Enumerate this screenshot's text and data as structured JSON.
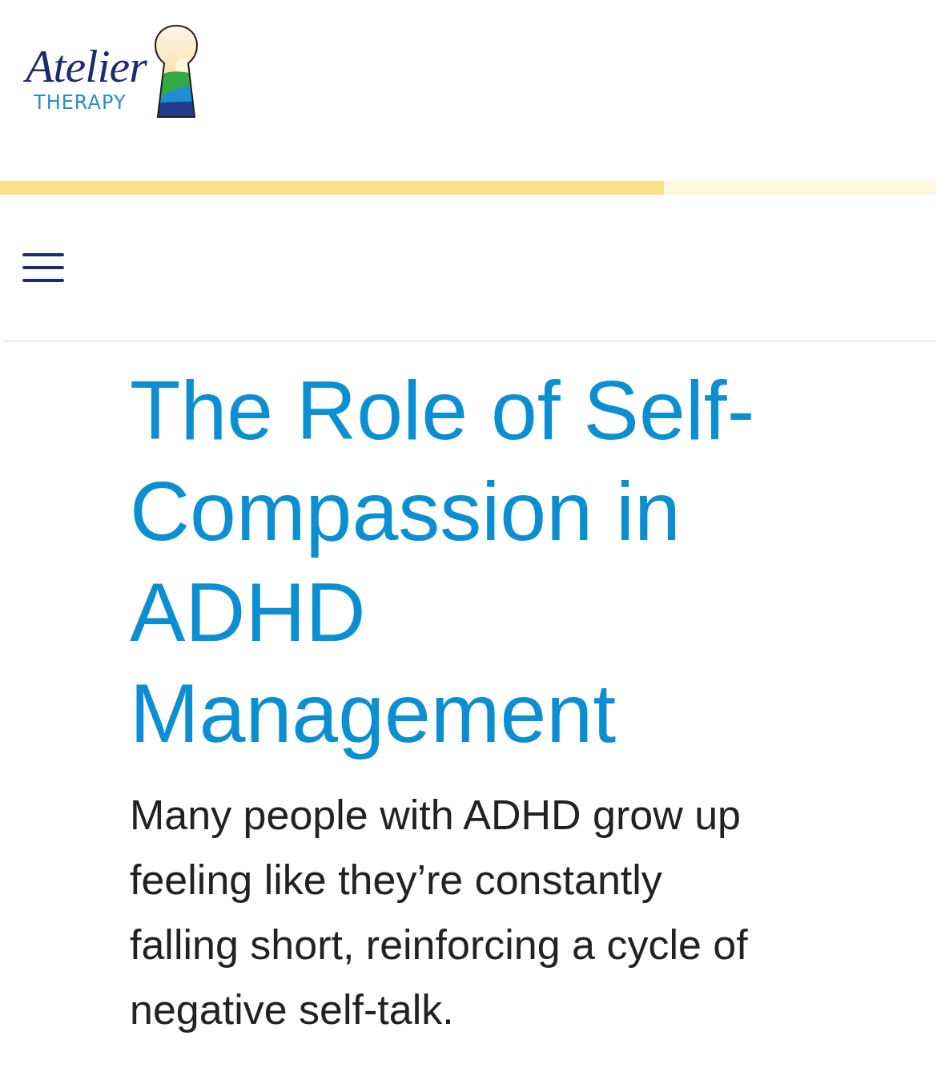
{
  "header": {
    "logo": {
      "script": "Atelier",
      "wordmark": "THERAPY"
    }
  },
  "reading_progress": {
    "level": 0.71
  },
  "article": {
    "title": "The Role of Self-Compassion in ADHD Management",
    "intro": "Many people with ADHD grow up feeling like they’re constantly falling short, reinforcing a cycle of negative self-talk."
  }
}
